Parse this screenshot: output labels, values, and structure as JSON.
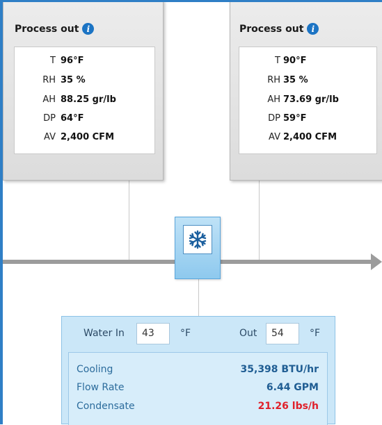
{
  "process_out_left": {
    "title": "Process out",
    "rows": [
      {
        "label": "T",
        "value": "96°F"
      },
      {
        "label": "RH",
        "value": "35 %"
      },
      {
        "label": "AH",
        "value": "88.25 gr/lb"
      },
      {
        "label": "DP",
        "value": "64°F"
      },
      {
        "label": "AV",
        "value": "2,400 CFM"
      }
    ]
  },
  "process_out_right": {
    "title": "Process out",
    "rows": [
      {
        "label": "T",
        "value": "90°F"
      },
      {
        "label": "RH",
        "value": "35 %"
      },
      {
        "label": "AH",
        "value": "73.69 gr/lb"
      },
      {
        "label": "DP",
        "value": "59°F"
      },
      {
        "label": "AV",
        "value": "2,400 CFM"
      }
    ]
  },
  "cooling_coil": {
    "icon": "snowflake-icon"
  },
  "water_panel": {
    "water_in_label": "Water In",
    "water_in_value": "43",
    "water_in_unit": "°F",
    "out_label": "Out",
    "out_value": "54",
    "out_unit": "°F",
    "results": [
      {
        "label": "Cooling",
        "value": "35,398 BTU/hr"
      },
      {
        "label": "Flow Rate",
        "value": "6.44 GPM"
      },
      {
        "label": "Condensate",
        "value": "21.26 lbs/h"
      }
    ]
  },
  "colors": {
    "frame_blue": "#2f7fc6",
    "info_icon": "#1c74c4",
    "result_value_blue": "#1f5d93",
    "alert_red": "#e0202a",
    "coil_blue": "#8ec9ee"
  }
}
